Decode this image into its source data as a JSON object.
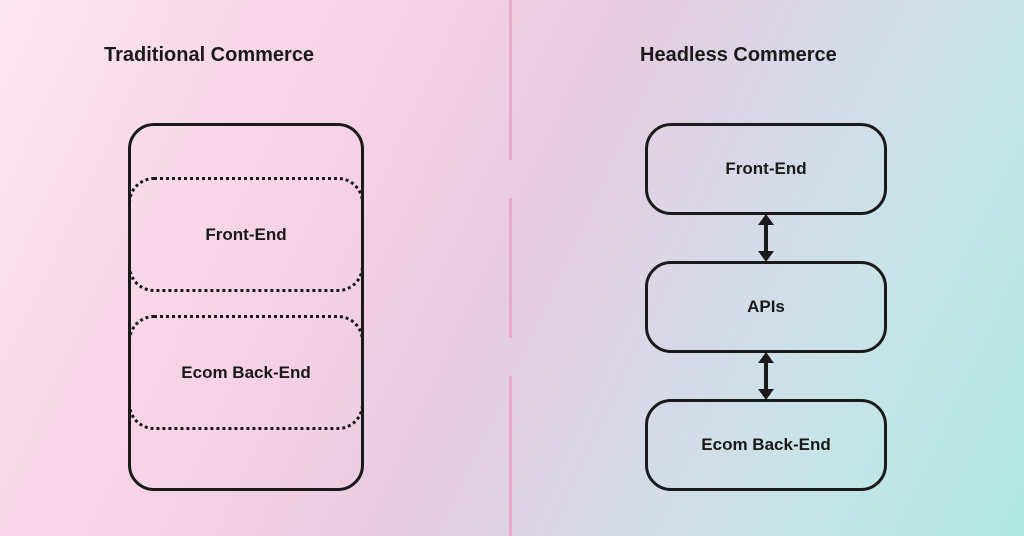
{
  "left": {
    "title": "Traditional Commerce",
    "front_end": "Front-End",
    "back_end": "Ecom Back-End"
  },
  "right": {
    "title": "Headless Commerce",
    "front_end": "Front-End",
    "apis": "APIs",
    "back_end": "Ecom Back-End"
  }
}
